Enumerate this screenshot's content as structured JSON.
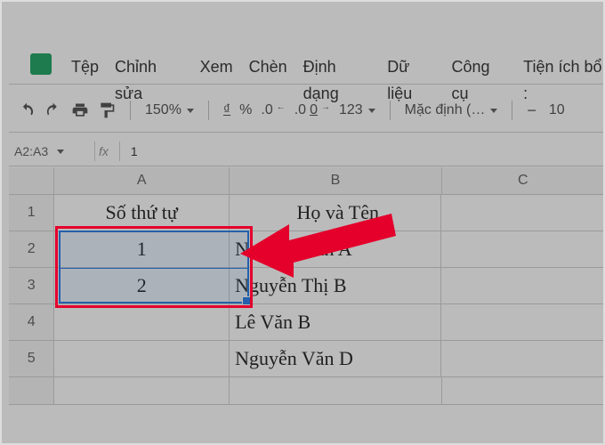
{
  "menu": {
    "file": "Tệp",
    "edit": "Chỉnh sửa",
    "view": "Xem",
    "insert": "Chèn",
    "format": "Định dạng",
    "data": "Dữ liệu",
    "tools": "Công cụ",
    "ext": "Tiện ích bổ :"
  },
  "toolbar": {
    "zoom": "150%",
    "currency": "₫",
    "percent": "%",
    "dec_less": ".0",
    "dec_more": ".00",
    "numfmt": "123",
    "fontname": "Mặc định (…",
    "fontsize": "10"
  },
  "namebox": "A2:A3",
  "fx_label": "fx",
  "fx_value": "1",
  "columns": {
    "A": "A",
    "B": "B",
    "C": "C"
  },
  "rows": {
    "r1": "1",
    "r2": "2",
    "r3": "3",
    "r4": "4",
    "r5": "5"
  },
  "cells": {
    "A1": "Số thứ tự",
    "B1": "Họ và Tên",
    "A2": "1",
    "B2": "Nguyễn Văn A",
    "A3": "2",
    "B3": "Nguyễn Thị B",
    "B4": "Lê Văn B",
    "B5": "Nguyễn Văn D"
  },
  "accent": "#1a73e8",
  "callout_color": "#e4002b"
}
